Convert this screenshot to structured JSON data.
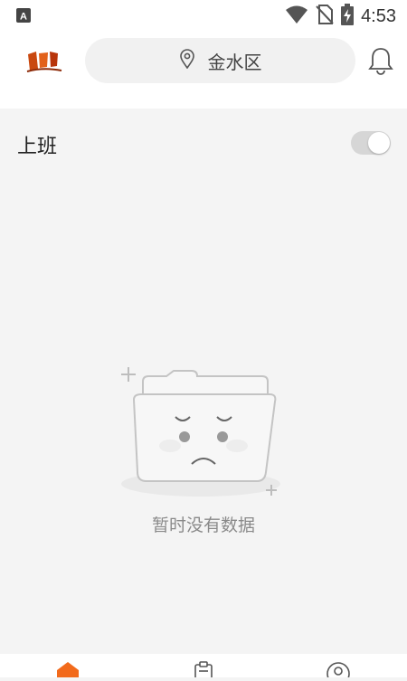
{
  "status_bar": {
    "time": "4:53",
    "notification_icon": "a-icon"
  },
  "header": {
    "logo_icon": "app-logo",
    "location": "金水区",
    "location_icon": "location-pin-icon",
    "bell_icon": "bell-icon"
  },
  "work_mode": {
    "label": "上班",
    "toggle_on": false
  },
  "empty_state": {
    "text": "暂时没有数据",
    "illustration": "empty-folder-sad-face"
  },
  "tab_bar": {
    "tabs": [
      {
        "name": "home",
        "icon": "home-icon",
        "active": true
      },
      {
        "name": "orders",
        "icon": "clipboard-icon",
        "active": false
      },
      {
        "name": "profile",
        "icon": "user-icon",
        "active": false
      }
    ]
  },
  "colors": {
    "accent": "#f26a1b",
    "background": "#f4f4f4",
    "toggle_off": "#d6d6d6"
  }
}
